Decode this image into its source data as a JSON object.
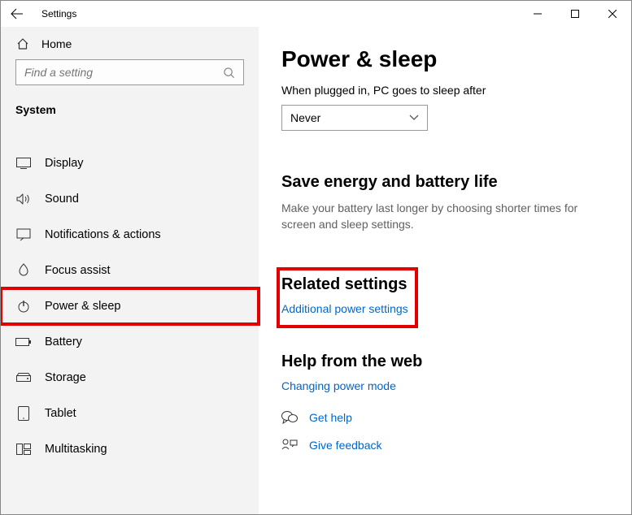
{
  "window": {
    "title": "Settings"
  },
  "sidebar": {
    "home_label": "Home",
    "search_placeholder": "Find a setting",
    "section_label": "System",
    "items": [
      {
        "label": "Display"
      },
      {
        "label": "Sound"
      },
      {
        "label": "Notifications & actions"
      },
      {
        "label": "Focus assist"
      },
      {
        "label": "Power & sleep"
      },
      {
        "label": "Battery"
      },
      {
        "label": "Storage"
      },
      {
        "label": "Tablet"
      },
      {
        "label": "Multitasking"
      }
    ]
  },
  "main": {
    "page_title": "Power & sleep",
    "sleep_label": "When plugged in, PC goes to sleep after",
    "sleep_value": "Never",
    "energy_heading": "Save energy and battery life",
    "energy_text": "Make your battery last longer by choosing shorter times for screen and sleep settings.",
    "related_heading": "Related settings",
    "related_link": "Additional power settings",
    "help_heading": "Help from the web",
    "help_link": "Changing power mode",
    "get_help_label": "Get help",
    "give_feedback_label": "Give feedback"
  }
}
